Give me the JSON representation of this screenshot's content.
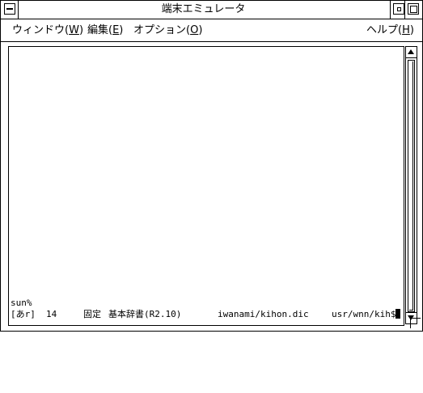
{
  "window": {
    "title": "端末エミュレータ"
  },
  "menubar": {
    "items": [
      {
        "label": "ウィンドウ(",
        "mnemonic": "W",
        "close": ")"
      },
      {
        "label": "編集(",
        "mnemonic": "E",
        "close": ")"
      },
      {
        "label": "オプション(",
        "mnemonic": "O",
        "close": ")"
      }
    ],
    "help": {
      "label": "ヘルプ(",
      "mnemonic": "H",
      "close": ")"
    }
  },
  "terminal": {
    "prompt": "sun%",
    "status": {
      "mode": "[あr]",
      "count": "14",
      "dict_type": "固定",
      "dict_name": "基本辞書(R2.10)",
      "dict_file": "iwanami/kihon.dic",
      "path": "usr/wnn/kih$"
    }
  },
  "colors": {
    "background": "#ffffff",
    "foreground": "#000000"
  }
}
